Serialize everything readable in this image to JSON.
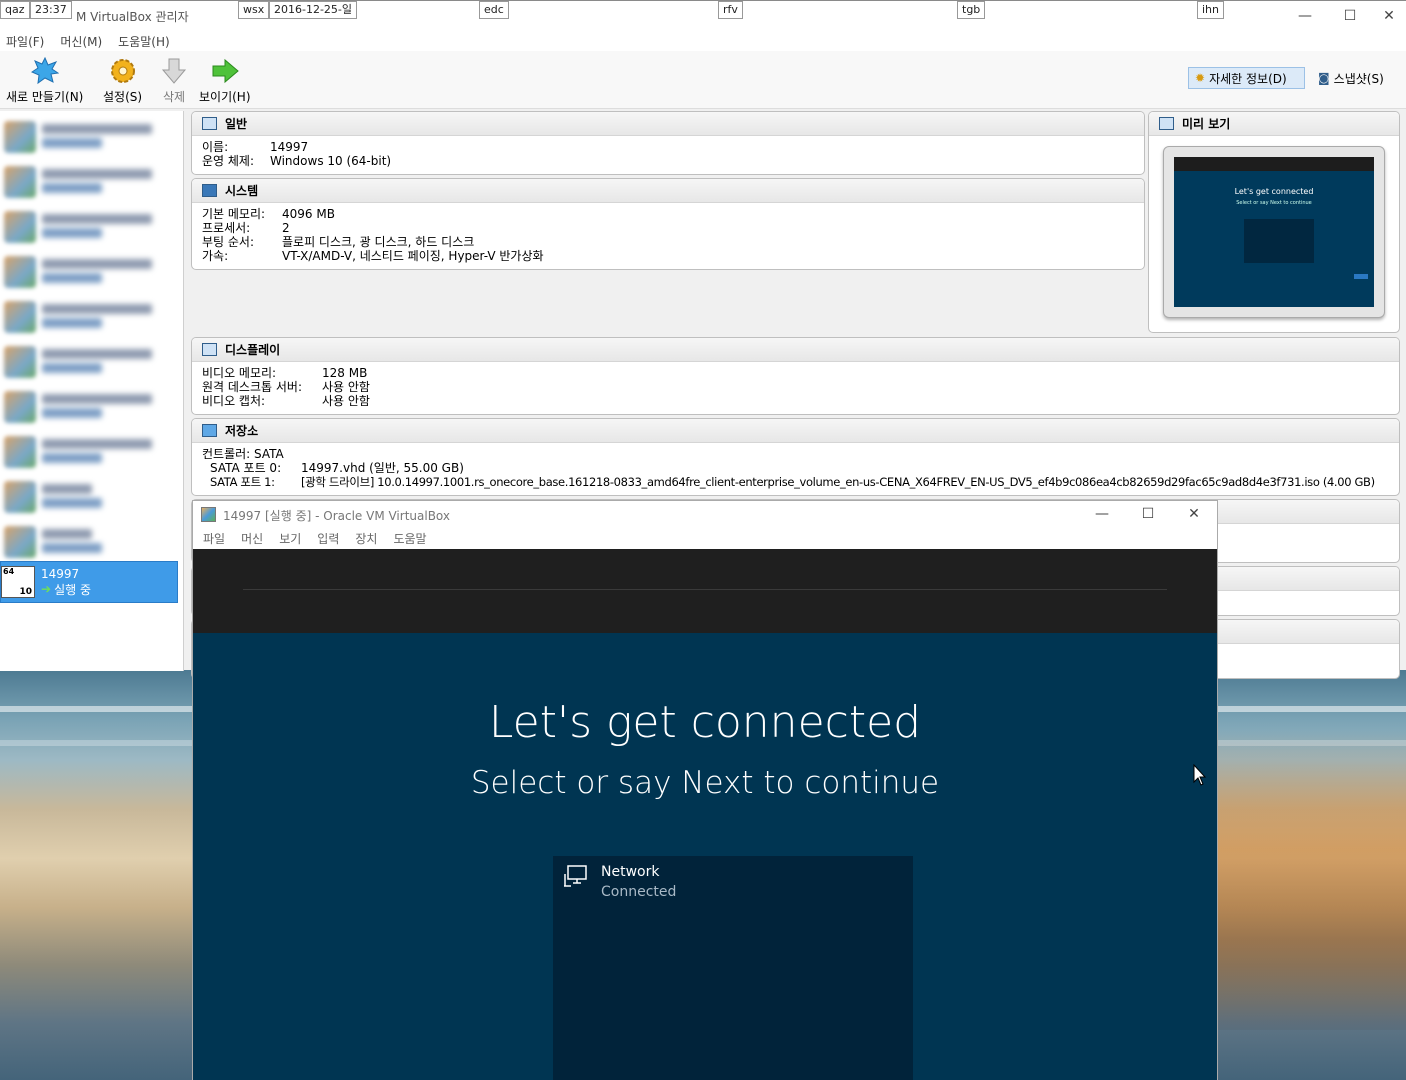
{
  "hotkeys": [
    {
      "label": "qaz"
    },
    {
      "label": "23:37"
    },
    {
      "label": "wsx"
    },
    {
      "label": "2016-12-25-일"
    },
    {
      "label": "edc"
    },
    {
      "label": "rfv"
    },
    {
      "label": "tgb"
    },
    {
      "label": "ihn"
    }
  ],
  "manager": {
    "title": "M VirtualBox 관리자",
    "menu": [
      "파일(F)",
      "머신(M)",
      "도움말(H)"
    ],
    "toolbar": {
      "new": "새로 만들기(N)",
      "settings": "설정(S)",
      "delete": "삭제",
      "show": "보이기(H)",
      "details": "자세한 정보(D)",
      "snapshots": "스냅샷(S)"
    },
    "selected_vm": {
      "name": "14997",
      "state": "실행 중",
      "badge_top": "64",
      "badge_bottom": "10"
    }
  },
  "details": {
    "general": {
      "header": "일반",
      "name_label": "이름:",
      "name_value": "14997",
      "os_label": "운영 체제:",
      "os_value": "Windows 10 (64-bit)"
    },
    "system": {
      "header": "시스템",
      "rows": [
        {
          "k": "기본 메모리:",
          "v": "4096 MB"
        },
        {
          "k": "프로세서:",
          "v": "2"
        },
        {
          "k": "부팅 순서:",
          "v": "플로피 디스크, 광 디스크, 하드 디스크"
        },
        {
          "k": "가속:",
          "v": "VT-X/AMD-V, 네스티드 페이징, Hyper-V 반가상화"
        }
      ]
    },
    "preview": {
      "header": "미리 보기",
      "title": "Let's get connected",
      "subtitle": "Select or say Next to continue"
    },
    "display": {
      "header": "디스플레이",
      "rows": [
        {
          "k": "비디오 메모리:",
          "v": "128 MB"
        },
        {
          "k": "원격 데스크톱 서버:",
          "v": "사용 안함"
        },
        {
          "k": "비디오 캡처:",
          "v": "사용 안함"
        }
      ]
    },
    "storage": {
      "header": "저장소",
      "controller": "컨트롤러: SATA",
      "rows": [
        {
          "k": "SATA 포트 0:",
          "v": "14997.vhd (일반, 55.00 GB)"
        },
        {
          "k": "SATA 포트 1:",
          "v": "[광학 드라이브] 10.0.14997.1001.rs_onecore_base.161218-0833_amd64fre_client-enterprise_volume_en-us-CENA_X64FREV_EN-US_DV5_ef4b9c086ea4cb82659d29fac65c9ad8d4e3f731.iso (4.00 GB)"
        }
      ]
    }
  },
  "vmwindow": {
    "title": "14997 [실행 중] - Oracle VM VirtualBox",
    "menu": [
      "파일",
      "머신",
      "보기",
      "입력",
      "장치",
      "도움말"
    ],
    "guest": {
      "heading": "Let's get connected",
      "subheading": "Select or say Next to continue",
      "network_name": "Network",
      "network_status": "Connected"
    }
  },
  "colors": {
    "accent": "#3f9be8",
    "guest_bg": "#003552",
    "guest_topbar": "#1f1f1f"
  }
}
